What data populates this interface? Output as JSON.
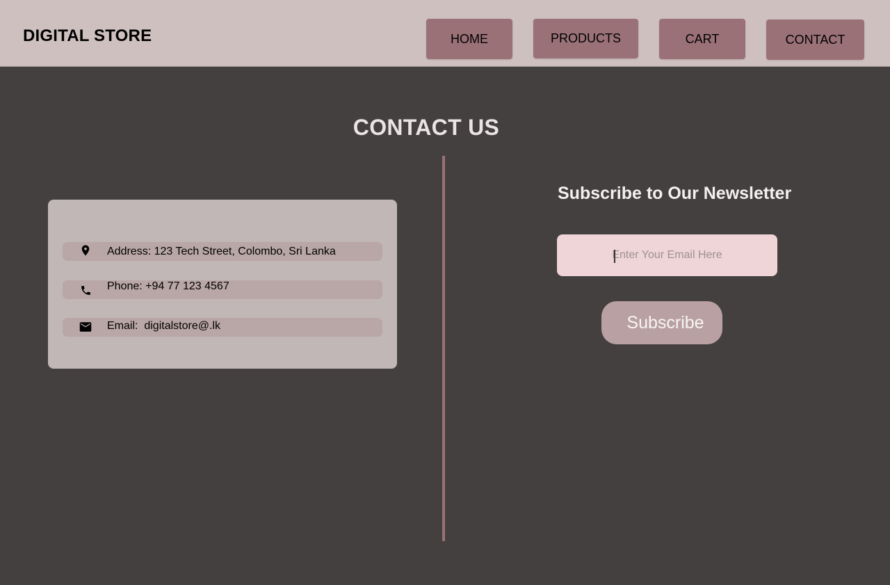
{
  "header": {
    "brand": "DIGITAL STORE",
    "nav": [
      {
        "label": "HOME"
      },
      {
        "label": "PRODUCTS"
      },
      {
        "label": "CART"
      },
      {
        "label": "CONTACT"
      }
    ]
  },
  "main": {
    "title": "CONTACT US",
    "contact": {
      "items": [
        {
          "icon": "location-pin-icon",
          "text": "Address: 123 Tech Street, Colombo, Sri Lanka"
        },
        {
          "icon": "phone-icon",
          "text": "Phone: +94 77 123 4567"
        },
        {
          "icon": "email-icon",
          "text": "Email:  digitalstore@.lk"
        }
      ]
    },
    "newsletter": {
      "title": "Subscribe to Our Newsletter",
      "email_placeholder": "Enter Your Email Here",
      "email_value": "",
      "button_label": "Subscribe"
    }
  },
  "colors": {
    "header_bg": "#cfc0c0",
    "page_bg": "#444040",
    "nav_button": "#9a7177",
    "card_bg": "#c1b7b7",
    "row_bg": "#b9a6a6",
    "input_bg": "#efd5d7",
    "subscribe_bg": "#b9a1a3"
  }
}
